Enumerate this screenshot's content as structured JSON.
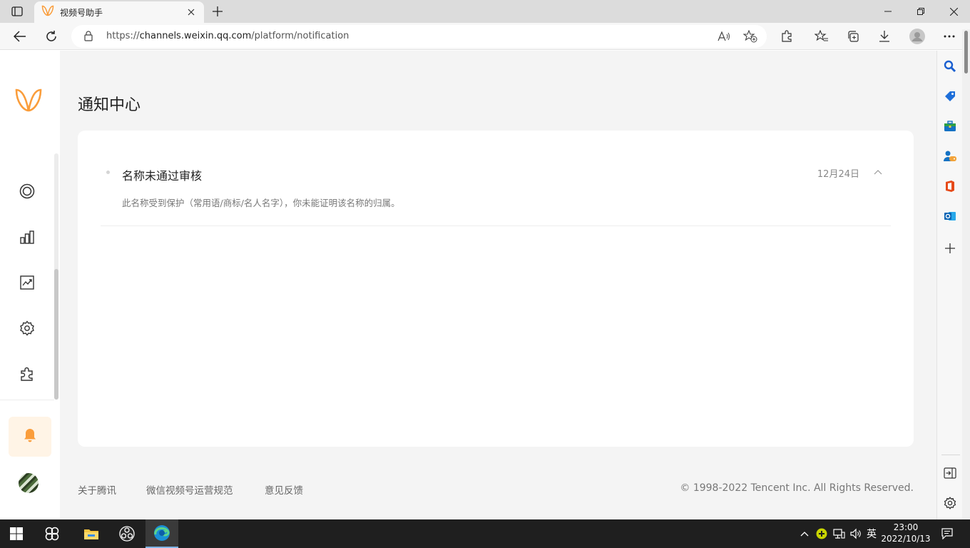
{
  "browser": {
    "tab_title": "视频号助手",
    "url_scheme": "https://",
    "url_host": "channels.weixin.qq.com",
    "url_path": "/platform/notification"
  },
  "page": {
    "title": "通知中心",
    "notifications": [
      {
        "title": "名称未通过审核",
        "date": "12月24日",
        "body": "此名称受到保护（常用语/商标/名人名字），你未能证明该名称的归属。"
      }
    ]
  },
  "footer": {
    "links": [
      "关于腾讯",
      "微信视频号运营规范",
      "意见反馈"
    ],
    "copyright": "© 1998-2022 Tencent Inc. All Rights Reserved."
  },
  "taskbar": {
    "ime": "英",
    "time": "23:00",
    "date": "2022/10/13"
  },
  "colors": {
    "accent": "#fa9d3b",
    "bell_bg": "#fff4e6",
    "page_bg": "#f4f4f4"
  }
}
